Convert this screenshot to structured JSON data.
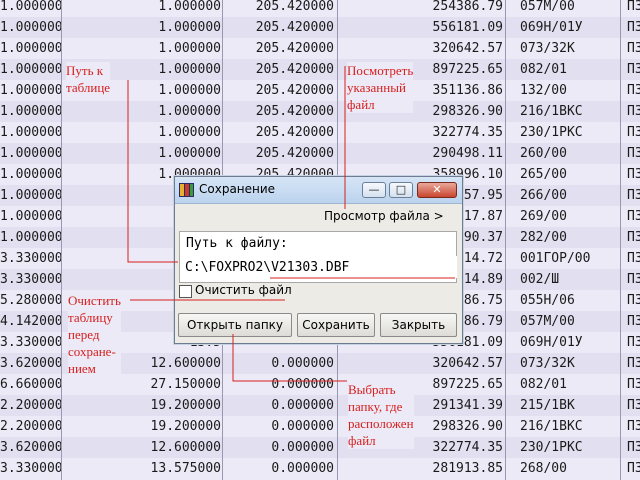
{
  "table": {
    "rows": [
      [
        "1.000000",
        "1.000000",
        "205.420000",
        "254386.79",
        "057M/00",
        "П3"
      ],
      [
        "1.000000",
        "1.000000",
        "205.420000",
        "556181.09",
        "069H/01У",
        "П3"
      ],
      [
        "1.000000",
        "1.000000",
        "205.420000",
        "320642.57",
        "073/32K",
        "П3"
      ],
      [
        "1.000000",
        "1.000000",
        "205.420000",
        "897225.65",
        "082/01",
        "П3"
      ],
      [
        "1.000000",
        "1.000000",
        "205.420000",
        "351136.86",
        "132/00",
        "П3"
      ],
      [
        "1.000000",
        "1.000000",
        "205.420000",
        "298326.90",
        "216/1BKC",
        "П3"
      ],
      [
        "1.000000",
        "1.000000",
        "205.420000",
        "322774.35",
        "230/1PKC",
        "П3"
      ],
      [
        "1.000000",
        "1.000000",
        "205.420000",
        "290498.11",
        "260/00",
        "П3"
      ],
      [
        "1.000000",
        "1.000000",
        "205.420000",
        "358996.10",
        "265/00",
        "П3"
      ],
      [
        "1.000000",
        "1.00",
        "",
        "357.95",
        "266/00",
        "П3"
      ],
      [
        "1.000000",
        "1.00",
        "",
        "317.87",
        "269/00",
        "П3"
      ],
      [
        "1.000000",
        "1.00",
        "",
        "390.37",
        "282/00",
        "П3"
      ],
      [
        "3.330000",
        "13.5",
        "",
        "314.72",
        "001ГОР/00",
        "П3"
      ],
      [
        "3.330000",
        "",
        "",
        "314.89",
        "002/Ш",
        "П3"
      ],
      [
        "5.280000",
        "19.6",
        "",
        "386.75",
        "055H/06",
        "П3"
      ],
      [
        "4.142000",
        "11.68",
        "",
        "386.79",
        "057M/00",
        "П3"
      ],
      [
        "3.330000",
        "13.5",
        "",
        "556181.09",
        "069H/01У",
        "П3"
      ],
      [
        "3.620000",
        "12.600000",
        "0.000000",
        "320642.57",
        "073/32K",
        "П3"
      ],
      [
        "6.660000",
        "27.150000",
        "0.000000",
        "897225.65",
        "082/01",
        "П3"
      ],
      [
        "2.200000",
        "19.200000",
        "0.000000",
        "291341.39",
        "215/1BK",
        "П3"
      ],
      [
        "2.200000",
        "19.200000",
        "0.000000",
        "298326.90",
        "216/1BKC",
        "П3"
      ],
      [
        "3.620000",
        "12.600000",
        "0.000000",
        "322774.35",
        "230/1PKC",
        "П3"
      ],
      [
        "3.330000",
        "13.575000",
        "0.000000",
        "281913.85",
        "268/00",
        "П3"
      ]
    ]
  },
  "dialog": {
    "title": "Сохранение",
    "view_file_link": "Просмотр файла >",
    "path_label": "Путь к файлу:",
    "path_value": "C:\\FOXPRO2\\V21303.DBF",
    "clear_label": "Очистить файл",
    "clear_checked": false,
    "buttons": {
      "open_folder": "Открыть папку",
      "save": "Сохранить",
      "close": "Закрыть"
    },
    "window_buttons": {
      "minimize": "—",
      "maximize": "□",
      "close": "✕"
    }
  },
  "annotations": {
    "path_to_table": "Путь к\nтаблице",
    "view_file": "Посмотреть\nуказанный\nфайл",
    "clear_table": "Очистить\nтаблицу\nперед\nсохране-\nнием",
    "choose_folder": "Выбрать\nпапку, где\nрасположен\nфайл"
  },
  "colors": {
    "annotation": "#d62020",
    "row_alt": "#e2e0f0",
    "page_bg": "#eceaf6"
  }
}
